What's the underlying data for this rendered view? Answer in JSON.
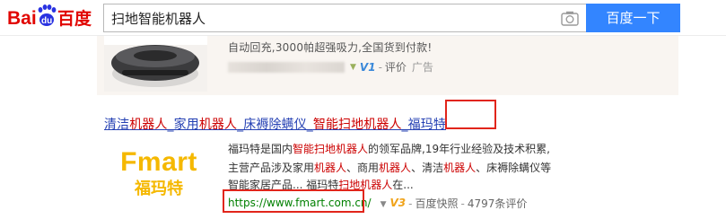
{
  "header": {
    "logo_text_left": "Bai",
    "logo_paw_text": "du",
    "logo_text_right": "百度",
    "search_value": "扫地智能机器人",
    "search_button_label": "百度一下"
  },
  "ad": {
    "description": "自动回充,3000帕超强吸力,全国货到付款!",
    "v_badge": "V1",
    "rating_link": "评价",
    "ad_label": "广告"
  },
  "result": {
    "title_segments": [
      {
        "text": "清洁",
        "highlight": false
      },
      {
        "text": "机器人",
        "highlight": true
      },
      {
        "text": "_家用",
        "highlight": false
      },
      {
        "text": "机器人",
        "highlight": true
      },
      {
        "text": "_床褥除螨仪_",
        "highlight": false
      },
      {
        "text": "智能扫地机器人",
        "highlight": true
      },
      {
        "text": "_福玛特",
        "highlight": false
      }
    ],
    "logo_text_en": "Fmart",
    "logo_text_cn": "福玛特",
    "snippet_line1": [
      {
        "text": "福玛特是国内",
        "highlight": false
      },
      {
        "text": "智能扫地机器人",
        "highlight": true
      },
      {
        "text": "的领军品牌,19年行业经验及技术积累,",
        "highlight": false
      }
    ],
    "snippet_line2": [
      {
        "text": "主营产品涉及家用",
        "highlight": false
      },
      {
        "text": "机器人",
        "highlight": true
      },
      {
        "text": "、商用",
        "highlight": false
      },
      {
        "text": "机器人",
        "highlight": true
      },
      {
        "text": "、清洁",
        "highlight": false
      },
      {
        "text": "机器人",
        "highlight": true
      },
      {
        "text": "、床褥除螨仪等",
        "highlight": false
      }
    ],
    "snippet_line3": [
      {
        "text": "智能家居产品... 福玛特",
        "highlight": false
      },
      {
        "text": "扫地机器人",
        "highlight": true
      },
      {
        "text": "在...",
        "highlight": false
      }
    ],
    "url": "https://www.fmart.com.cn/",
    "v_badge": "V3",
    "snapshot_link": "百度快照",
    "reviews_link": "4797条评价"
  },
  "colors": {
    "brand_blue": "#3385ff",
    "logo_red": "#e10602",
    "title_blue": "#2440b3",
    "highlight_red": "#cc0000",
    "url_green": "#008000",
    "annotation_red": "#e1251b",
    "fmart_yellow": "#f5b800"
  },
  "icons": [
    "baidu-paw-icon",
    "camera-icon",
    "chevron-down-icon"
  ]
}
